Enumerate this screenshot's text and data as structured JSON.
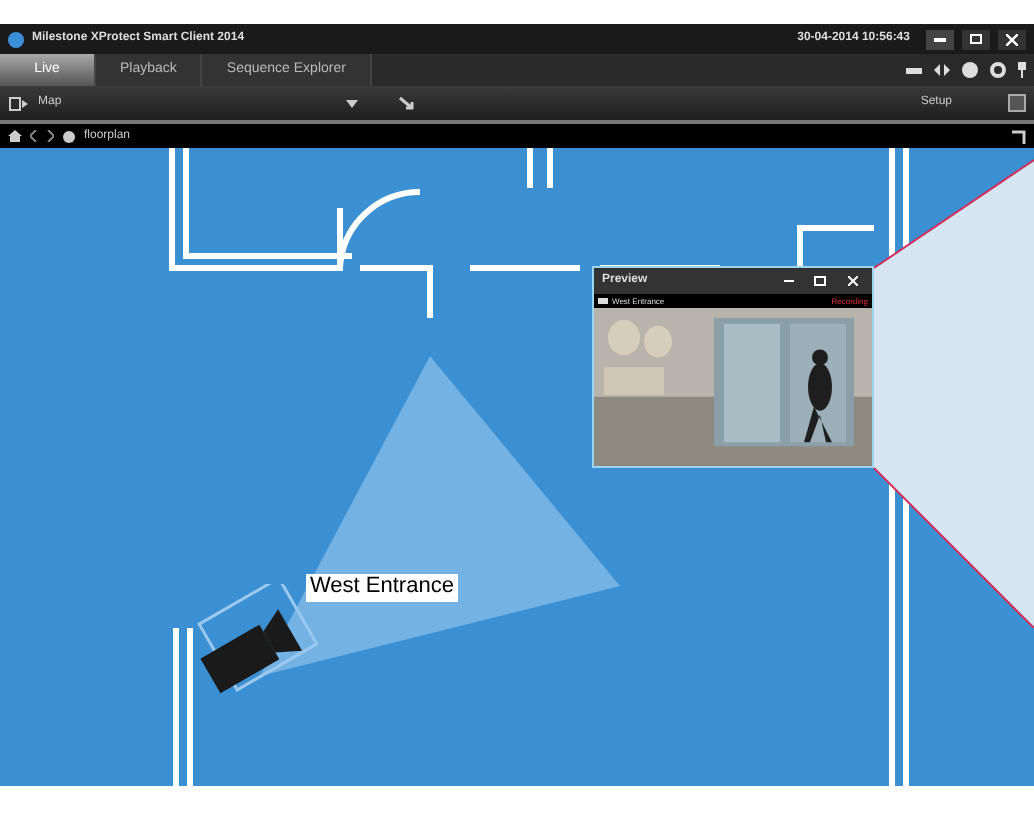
{
  "window": {
    "title": "Milestone XProtect Smart Client 2014",
    "datetime": "30-04-2014 10:56:43"
  },
  "tabs": [
    {
      "label": "Live",
      "selected": true
    },
    {
      "label": "Playback",
      "selected": false
    },
    {
      "label": "Sequence Explorer",
      "selected": false
    }
  ],
  "toolbar": {
    "view": "Map",
    "setup": "Setup"
  },
  "breadcrumb": {
    "item": "floorplan"
  },
  "map": {
    "camera_label": "West Entrance"
  },
  "preview": {
    "title": "Preview",
    "camera": "West Entrance",
    "status": "Recording"
  }
}
